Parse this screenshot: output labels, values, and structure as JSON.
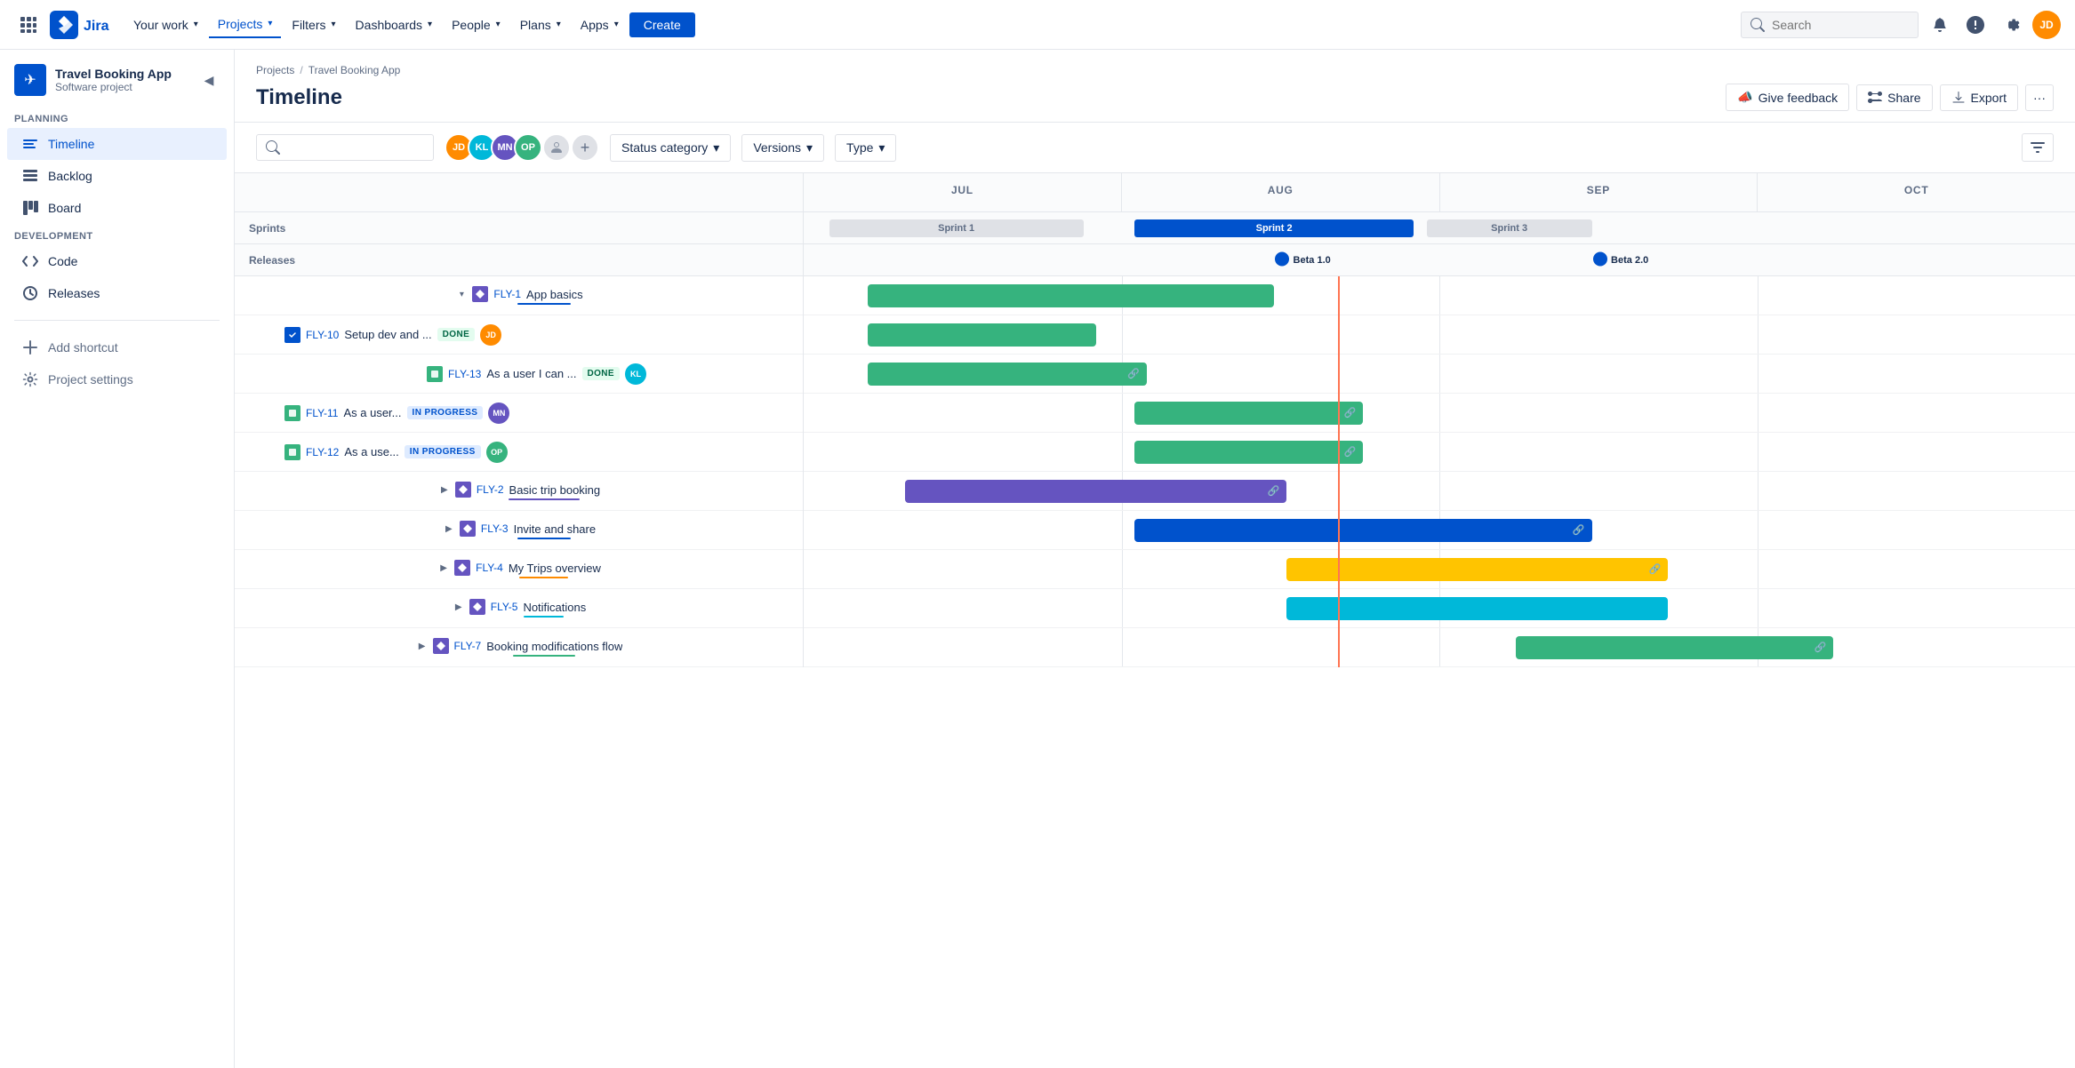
{
  "topnav": {
    "logo_text": "Jira",
    "your_work": "Your work",
    "projects": "Projects",
    "filters": "Filters",
    "dashboards": "Dashboards",
    "people": "People",
    "plans": "Plans",
    "apps": "Apps",
    "create": "Create",
    "search_placeholder": "Search"
  },
  "sidebar": {
    "project_name": "Travel Booking App",
    "project_type": "Software project",
    "planning_label": "PLANNING",
    "timeline": "Timeline",
    "backlog": "Backlog",
    "board": "Board",
    "development_label": "DEVELOPMENT",
    "code": "Code",
    "releases": "Releases",
    "add_shortcut": "Add shortcut",
    "project_settings": "Project settings"
  },
  "page": {
    "breadcrumb_projects": "Projects",
    "breadcrumb_app": "Travel Booking App",
    "title": "Timeline",
    "give_feedback": "Give feedback",
    "share": "Share",
    "export": "Export"
  },
  "filters": {
    "status_category": "Status category",
    "versions": "Versions",
    "type": "Type"
  },
  "timeline": {
    "months": [
      "JUL",
      "AUG",
      "SEP",
      "OCT"
    ],
    "sprints_label": "Sprints",
    "releases_label": "Releases",
    "sprint1": "Sprint 1",
    "sprint2": "Sprint 2",
    "sprint3": "Sprint 3",
    "beta1": "Beta 1.0",
    "beta2": "Beta 2.0",
    "issues": [
      {
        "id": "FLY-1",
        "name": "App basics",
        "type": "epic",
        "indent": 0,
        "collapsed": false,
        "underline_color": "#0052cc"
      },
      {
        "id": "FLY-10",
        "name": "Setup dev and ...",
        "type": "task",
        "indent": 1,
        "status": "DONE",
        "avatar": "orange"
      },
      {
        "id": "FLY-13",
        "name": "As a user I can ...",
        "type": "story",
        "indent": 1,
        "status": "DONE",
        "avatar": "teal"
      },
      {
        "id": "FLY-11",
        "name": "As a user...",
        "type": "story",
        "indent": 1,
        "status": "IN PROGRESS",
        "avatar": "purple"
      },
      {
        "id": "FLY-12",
        "name": "As a use...",
        "type": "story",
        "indent": 1,
        "status": "IN PROGRESS",
        "avatar": "green"
      },
      {
        "id": "FLY-2",
        "name": "Basic trip booking",
        "type": "epic",
        "indent": 0,
        "collapsed": true,
        "underline_color": "#6554c0"
      },
      {
        "id": "FLY-3",
        "name": "Invite and share",
        "type": "epic",
        "indent": 0,
        "collapsed": true,
        "underline_color": "#0052cc"
      },
      {
        "id": "FLY-4",
        "name": "My Trips overview",
        "type": "epic",
        "indent": 0,
        "collapsed": true,
        "underline_color": "#ff8b00"
      },
      {
        "id": "FLY-5",
        "name": "Notifications",
        "type": "epic",
        "indent": 0,
        "collapsed": true,
        "underline_color": "#00b8d9"
      },
      {
        "id": "FLY-7",
        "name": "Booking modifications flow",
        "type": "epic",
        "indent": 0,
        "collapsed": true,
        "underline_color": "#36b37e"
      }
    ]
  }
}
